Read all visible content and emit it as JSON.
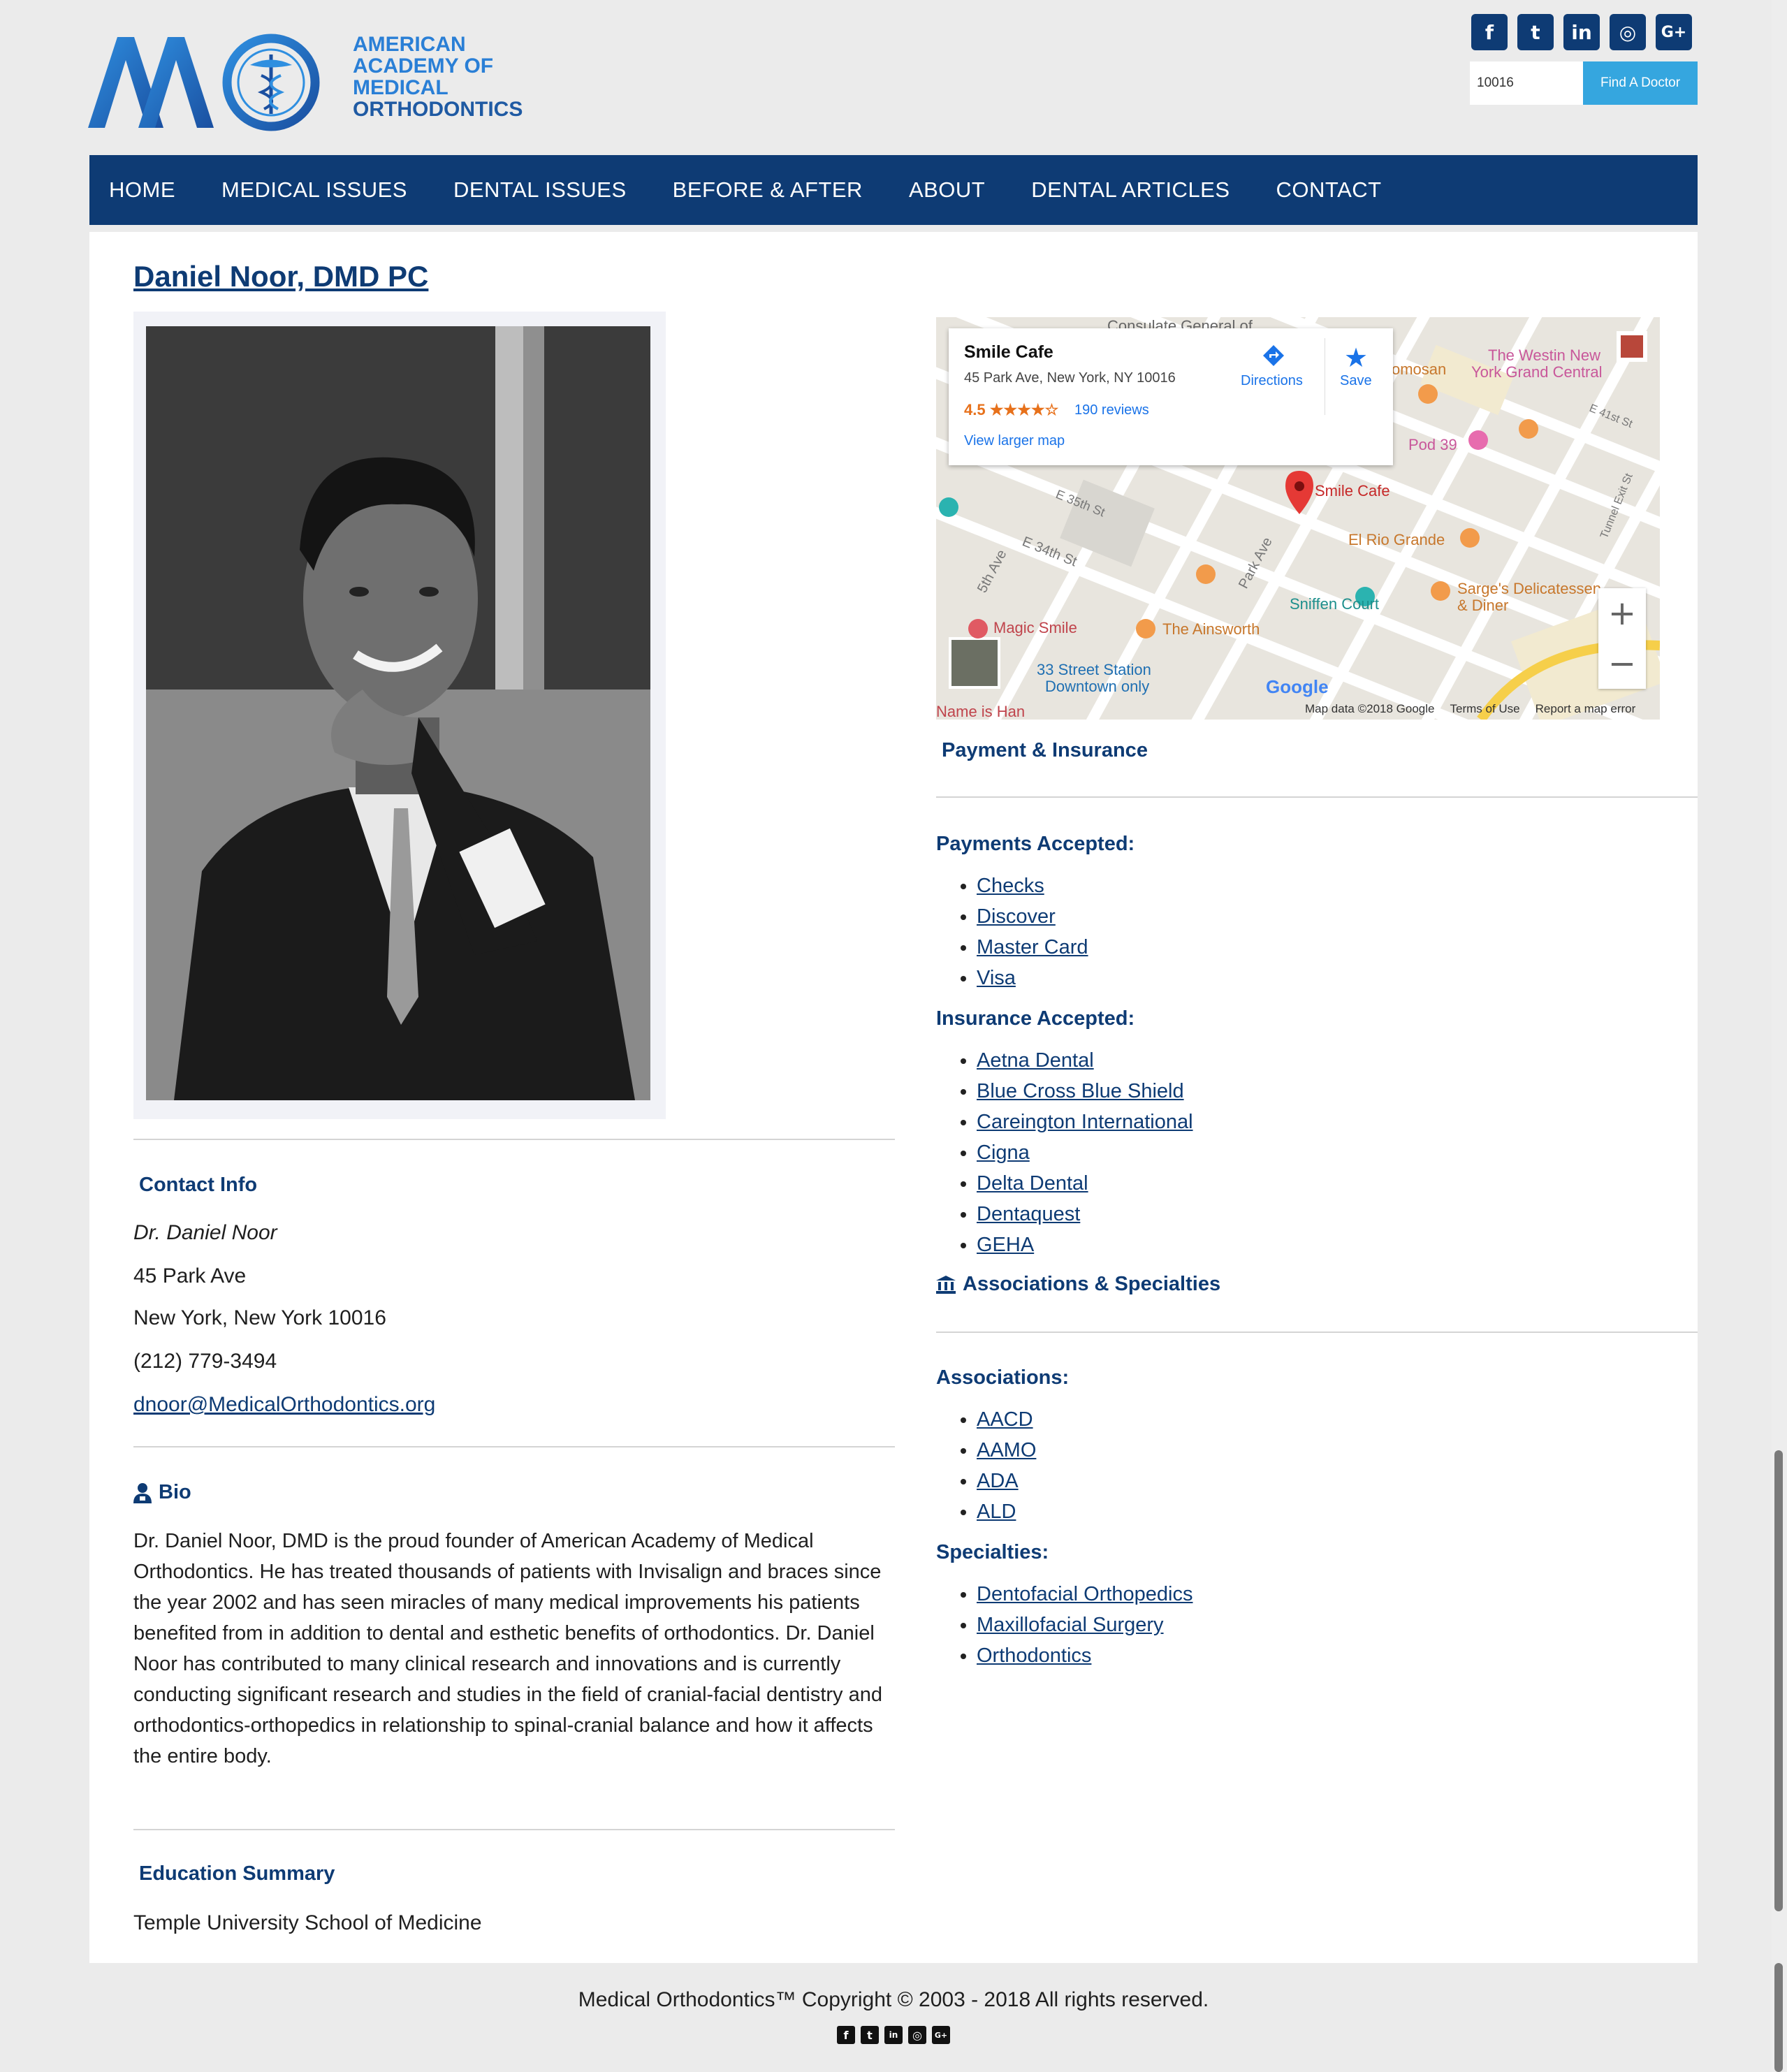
{
  "site": {
    "logo_text_lines": [
      "AMERICAN",
      "ACADEMY OF",
      "MEDICAL",
      "ORTHODONTICS"
    ],
    "logo_letters": "AAMO"
  },
  "social": [
    {
      "name": "facebook",
      "glyph": "f"
    },
    {
      "name": "twitter",
      "glyph": "t"
    },
    {
      "name": "linkedin",
      "glyph": "in"
    },
    {
      "name": "instagram",
      "glyph": "◎"
    },
    {
      "name": "google-plus",
      "glyph": "G+"
    }
  ],
  "search": {
    "value": "10016",
    "button": "Find A Doctor"
  },
  "nav": [
    "HOME",
    "MEDICAL ISSUES",
    "DENTAL ISSUES",
    "BEFORE & AFTER",
    "ABOUT",
    "DENTAL ARTICLES",
    "CONTACT"
  ],
  "doctor": {
    "title": "Daniel Noor, DMD PC"
  },
  "contact": {
    "heading": "Contact Info",
    "name": "Dr. Daniel Noor",
    "address1": "45 Park Ave",
    "address2": "New York, New York 10016",
    "phone": "(212) 779-3494",
    "email": "dnoor@MedicalOrthodontics.org"
  },
  "bio": {
    "heading": "Bio",
    "text": "Dr. Daniel Noor, DMD is the proud founder of American Academy of Medical Orthodontics. He has treated thousands of patients with Invisalign and braces since the year 2002 and has seen miracles of many medical improvements his patients benefited from in addition to dental and esthetic benefits of orthodontics. Dr. Daniel Noor has contributed to many clinical research and innovations and is currently conducting significant research and studies in the field of cranial-facial dentistry and orthodontics-orthopedics in relationship to spinal-cranial balance and how it affects the entire body."
  },
  "education": {
    "heading": "Education Summary",
    "school": "Temple University School of Medicine"
  },
  "map": {
    "place_name": "Smile Cafe",
    "place_address": "45 Park Ave, New York, NY 10016",
    "rating": "4.5 ★★★★☆",
    "reviews": "190 reviews",
    "larger_map": "View larger map",
    "directions": "Directions",
    "save": "Save",
    "labels": {
      "consulate": "Consulate General of",
      "westin": "The Westin New",
      "westin2": "York Grand Central",
      "omosan": "omosan",
      "pod39": "Pod 39",
      "smile_cafe": "Smile Cafe",
      "el_rio": "El Rio Grande",
      "sniffen": "Sniffen Court",
      "sarges": "Sarge's Delicatessen",
      "sarges2": "& Diner",
      "magic": "Magic Smile",
      "ainsworth": "The Ainsworth",
      "station": "33 Street Station",
      "station2": "Downtown only",
      "han": "Name is Han",
      "e35": "E 35th St",
      "e34": "E 34th St",
      "fifth": "5th Ave",
      "park": "Park Ave",
      "e41": "E 41st St",
      "tunnel": "Tunnel Exit St",
      "google": "Google"
    },
    "attribution": [
      "Map data ©2018 Google",
      "Terms of Use",
      "Report a map error"
    ],
    "zoom_in": "+",
    "zoom_out": "−"
  },
  "payment": {
    "heading": "Payment & Insurance",
    "payments_heading": "Payments Accepted:",
    "payments": [
      "Checks",
      "Discover",
      "Master Card",
      "Visa"
    ],
    "insurance_heading": "Insurance Accepted:",
    "insurance": [
      "Aetna Dental",
      "Blue Cross Blue Shield",
      "Careington International",
      "Cigna",
      "Delta Dental",
      "Dentaquest",
      "GEHA"
    ]
  },
  "associations": {
    "heading": "Associations & Specialties",
    "assoc_heading": "Associations:",
    "assoc": [
      "AACD",
      "AAMO",
      "ADA",
      "ALD"
    ],
    "spec_heading": "Specialties:",
    "spec": [
      "Dentofacial Orthopedics",
      "Maxillofacial Surgery",
      "Orthodontics"
    ]
  },
  "footer": {
    "copyright": "Medical Orthodontics™ Copyright © 2003 - 2018 All rights reserved."
  },
  "colors": {
    "navy": "#0e3b74",
    "accent": "#35a6df",
    "logo_blue": "#2a7fd6"
  }
}
